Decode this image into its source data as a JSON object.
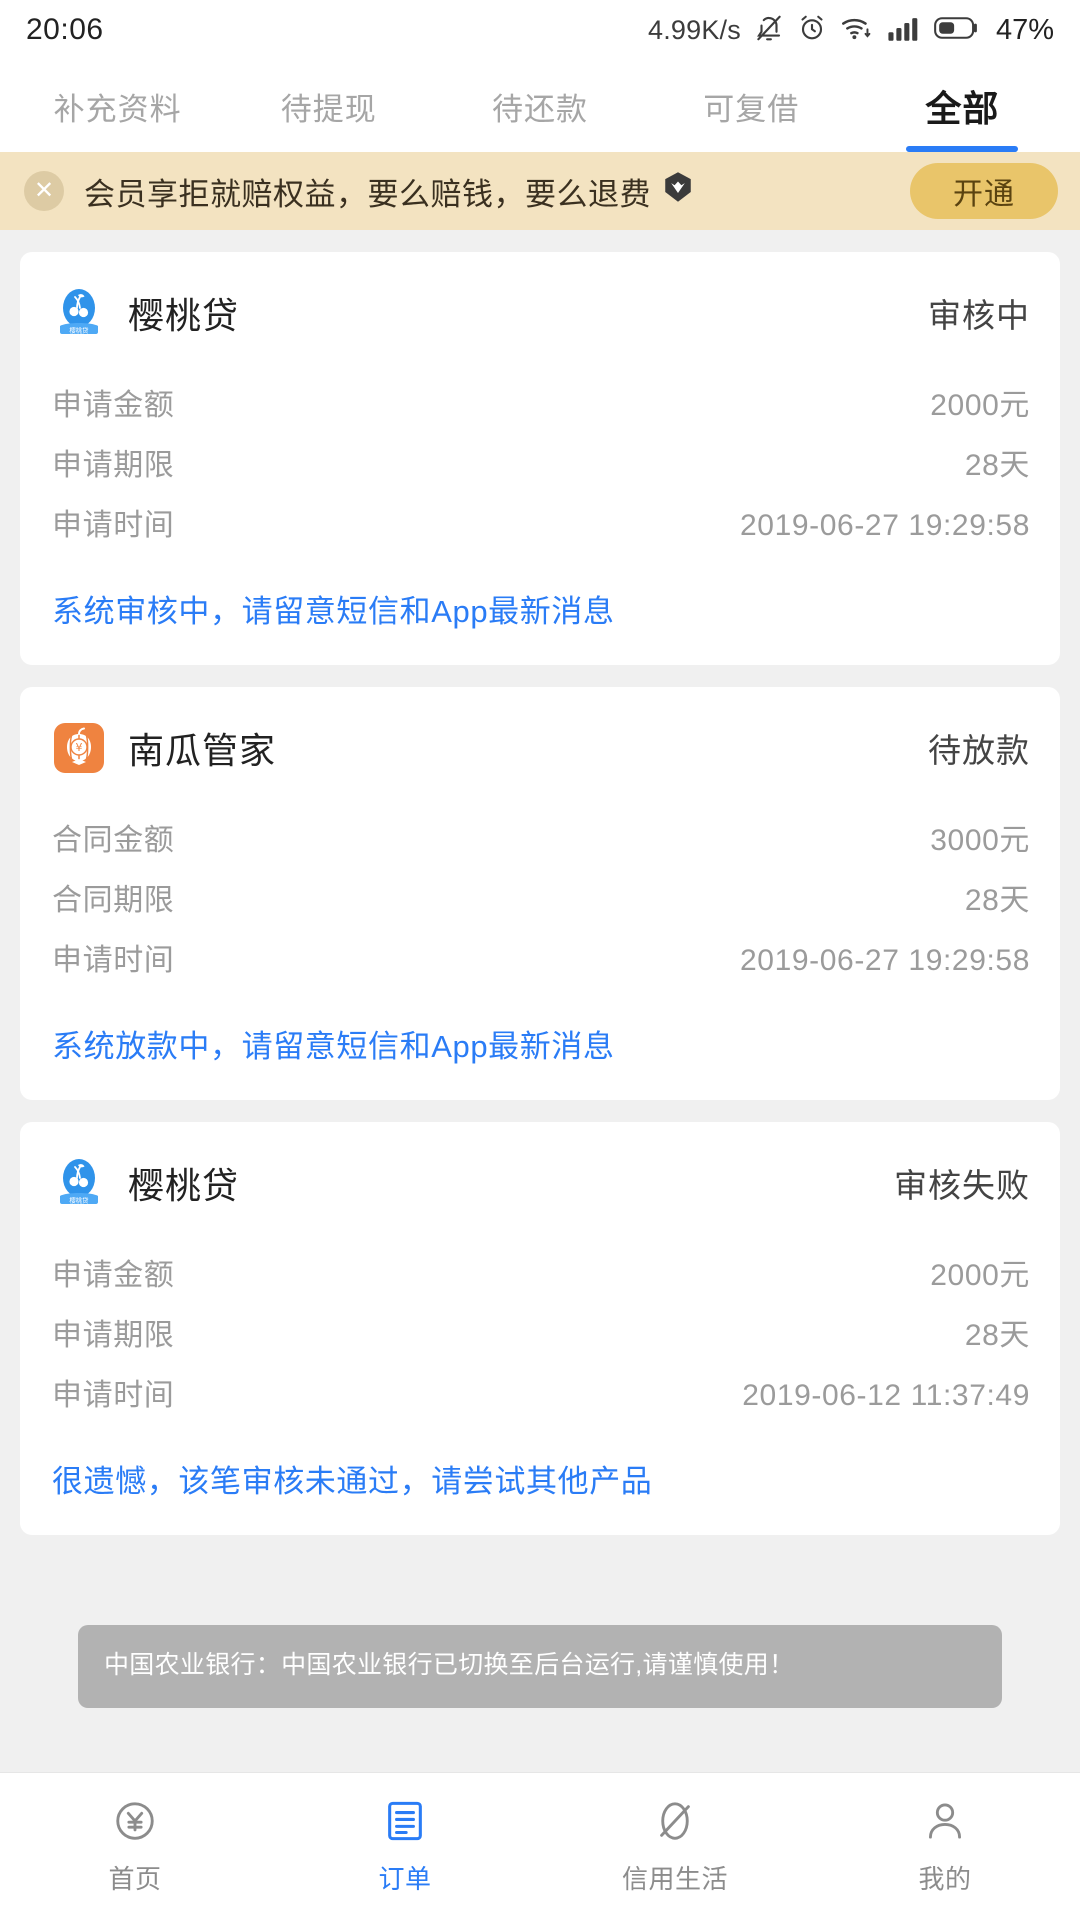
{
  "statusbar": {
    "time": "20:06",
    "network_speed": "4.99K/s",
    "battery_percent": "47%",
    "icons": [
      "mute-bell-icon",
      "alarm-clock-icon",
      "wifi-icon",
      "signal-bars-icon",
      "battery-icon"
    ]
  },
  "tabs": [
    {
      "label": "补充资料",
      "active": false
    },
    {
      "label": "待提现",
      "active": false
    },
    {
      "label": "待还款",
      "active": false
    },
    {
      "label": "可复借",
      "active": false
    },
    {
      "label": "全部",
      "active": true
    }
  ],
  "promo": {
    "close_label": "✕",
    "text": "会员享拒就赔权益，要么赔钱，要么退费",
    "badge": "diamond-badge-icon",
    "button_label": "开通",
    "bg_color": "#f3e3c1",
    "button_color": "#e9c56a"
  },
  "orders": [
    {
      "logo": "cherry-loan-logo",
      "product": "樱桃贷",
      "status": "审核中",
      "rows": [
        {
          "label": "申请金额",
          "value": "2000元"
        },
        {
          "label": "申请期限",
          "value": "28天"
        },
        {
          "label": "申请时间",
          "value": "2019-06-27 19:29:58"
        }
      ],
      "note": "系统审核中，请留意短信和App最新消息"
    },
    {
      "logo": "pumpkin-steward-logo",
      "product": "南瓜管家",
      "status": "待放款",
      "rows": [
        {
          "label": "合同金额",
          "value": "3000元"
        },
        {
          "label": "合同期限",
          "value": "28天"
        },
        {
          "label": "申请时间",
          "value": "2019-06-27 19:29:58"
        }
      ],
      "note": "系统放款中，请留意短信和App最新消息"
    },
    {
      "logo": "cherry-loan-logo",
      "product": "樱桃贷",
      "status": "审核失败",
      "rows": [
        {
          "label": "申请金额",
          "value": "2000元"
        },
        {
          "label": "申请期限",
          "value": "28天"
        },
        {
          "label": "申请时间",
          "value": "2019-06-12 11:37:49"
        }
      ],
      "note": "很遗憾，该笔审核未通过，请尝试其他产品"
    }
  ],
  "toast": {
    "message": "中国农业银行：中国农业银行已切换至后台运行,请谨慎使用！"
  },
  "bottomnav": [
    {
      "label": "首页",
      "icon": "yen-circle-icon",
      "active": false
    },
    {
      "label": "订单",
      "icon": "order-list-icon",
      "active": true
    },
    {
      "label": "信用生活",
      "icon": "credit-life-icon",
      "active": false
    },
    {
      "label": "我的",
      "icon": "person-icon",
      "active": false
    }
  ],
  "colors": {
    "accent": "#2a7cf6",
    "muted": "#9b9b9b",
    "promo_bg": "#f3e3c1"
  }
}
